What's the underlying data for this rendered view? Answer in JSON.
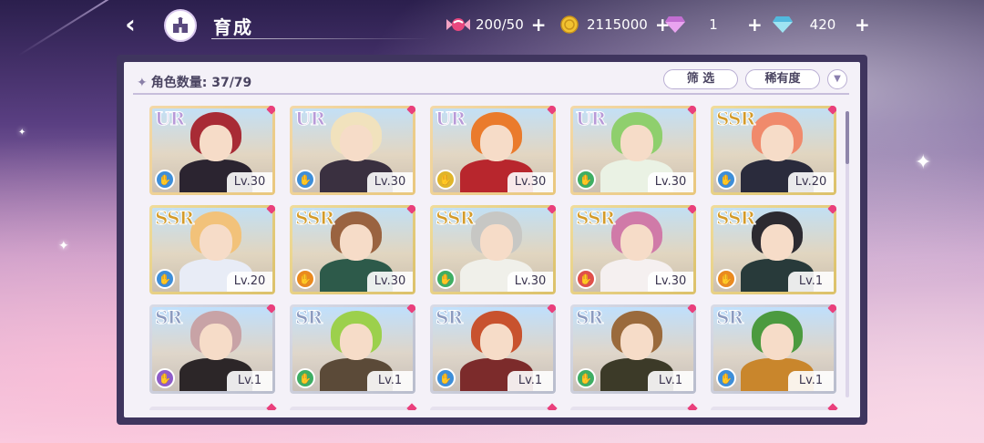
{
  "header": {
    "title": "育成",
    "back_icon": "back-arrow-icon",
    "home_icon": "castle-icon"
  },
  "resources": {
    "candy": {
      "icon": "candy-icon",
      "value": "200/50",
      "plus": "+"
    },
    "coin": {
      "icon": "coin-icon",
      "value": "2115000",
      "plus": "+"
    },
    "pink_gem": {
      "icon": "pink-diamond-icon",
      "value": "1",
      "plus": "+"
    },
    "blue_gem": {
      "icon": "blue-diamond-icon",
      "value": "420",
      "plus": "+"
    }
  },
  "panel": {
    "count_label": "角色数量: 37/79",
    "filter_label": "筛 选",
    "sort_label": "稀有度",
    "sort_order_icon": "chevron-down-icon"
  },
  "colors": {
    "accent_pink": "#ea3f7c",
    "panel_frame": "#3f355e",
    "attr_blue": "#3e8ed8",
    "attr_yellow": "#e0b52a",
    "attr_green": "#3fae63",
    "attr_orange": "#ea8a1f",
    "attr_red": "#e0504a",
    "attr_purple": "#8f5cc8"
  },
  "cards": [
    {
      "rarity": "UR",
      "level": "Lv.30",
      "attr": "blue",
      "hair": "#a82b35",
      "body": "#2b2430"
    },
    {
      "rarity": "UR",
      "level": "Lv.30",
      "attr": "blue",
      "hair": "#f1e2bd",
      "body": "#3a3040"
    },
    {
      "rarity": "UR",
      "level": "Lv.30",
      "attr": "yellow",
      "hair": "#ea7b2c",
      "body": "#b8262d"
    },
    {
      "rarity": "UR",
      "level": "Lv.30",
      "attr": "green",
      "hair": "#8fcf6d",
      "body": "#eaf2e4"
    },
    {
      "rarity": "SSR",
      "level": "Lv.20",
      "attr": "blue",
      "hair": "#f08a6c",
      "body": "#2a2b3c"
    },
    {
      "rarity": "SSR",
      "level": "Lv.20",
      "attr": "blue",
      "hair": "#f2c27a",
      "body": "#e8ecf6"
    },
    {
      "rarity": "SSR",
      "level": "Lv.30",
      "attr": "orange",
      "hair": "#9a6340",
      "body": "#2d5a4a"
    },
    {
      "rarity": "SSR",
      "level": "Lv.30",
      "attr": "green",
      "hair": "#c7c7c4",
      "body": "#f0f0ea"
    },
    {
      "rarity": "SSR",
      "level": "Lv.30",
      "attr": "red",
      "hair": "#d07aa8",
      "body": "#f5f0f0"
    },
    {
      "rarity": "SSR",
      "level": "Lv.1",
      "attr": "orange",
      "hair": "#2c2a30",
      "body": "#283a3a"
    },
    {
      "rarity": "SR",
      "level": "Lv.1",
      "attr": "purple",
      "hair": "#c8a3a6",
      "body": "#2c2628"
    },
    {
      "rarity": "SR",
      "level": "Lv.1",
      "attr": "green",
      "hair": "#9cd04c",
      "body": "#5b4a38"
    },
    {
      "rarity": "SR",
      "level": "Lv.1",
      "attr": "blue",
      "hair": "#c8522e",
      "body": "#7c2b2b"
    },
    {
      "rarity": "SR",
      "level": "Lv.1",
      "attr": "green",
      "hair": "#9a6a3c",
      "body": "#3c3a28"
    },
    {
      "rarity": "SR",
      "level": "Lv.1",
      "attr": "blue",
      "hair": "#4b9a3f",
      "body": "#c9862c"
    }
  ]
}
